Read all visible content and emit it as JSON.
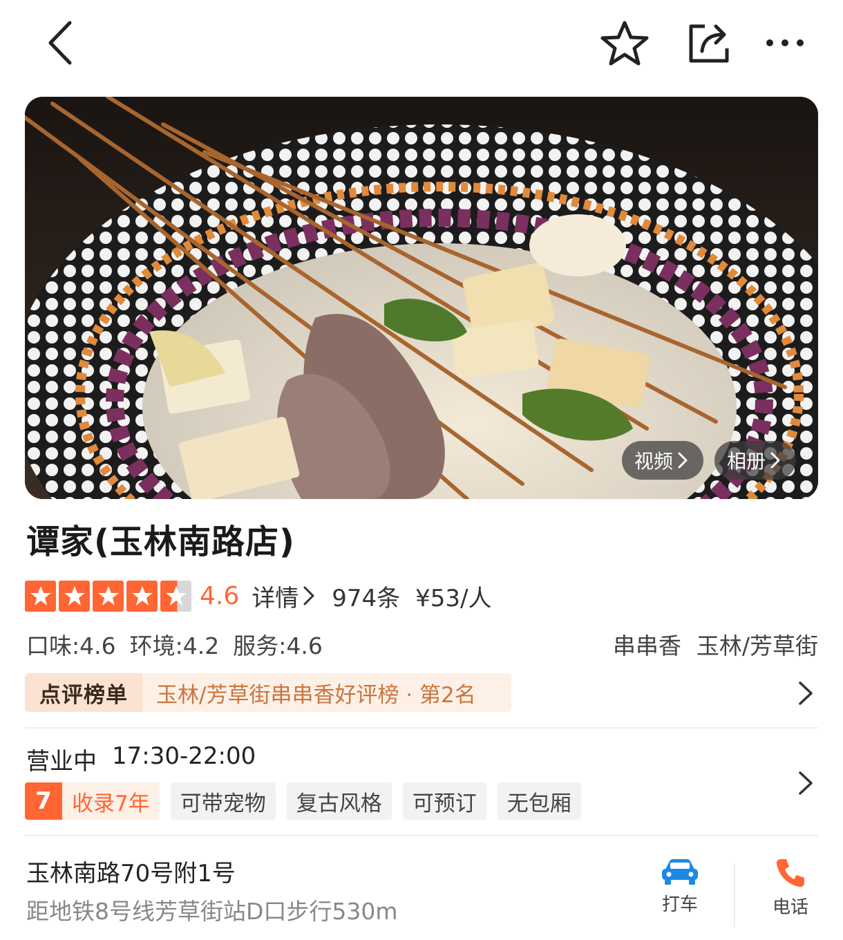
{
  "nav": {
    "back_icon": "chevron-left-icon",
    "favorite_icon": "star-outline-icon",
    "share_icon": "share-icon",
    "more_icon": "more-dots-icon"
  },
  "hero": {
    "video_label": "视频",
    "album_label": "相册"
  },
  "shop": {
    "name": "谭家(玉林南路店)",
    "rating_stars": 4.5,
    "score": "4.6",
    "detail_label": "详情",
    "reviews": "974条",
    "price": "¥53/人",
    "subscores": {
      "taste": "口味:4.6",
      "environment": "环境:4.2",
      "service": "服务:4.6"
    },
    "category": "串串香",
    "area": "玉林/芳草街"
  },
  "ranking": {
    "badge": "点评榜单",
    "text": "玉林/芳草街串串香好评榜 · 第2名"
  },
  "hours": {
    "status": "营业中",
    "time": "17:30-22:00"
  },
  "tags": {
    "years_num": "7",
    "years_text": "收录7年",
    "items": [
      "可带宠物",
      "复古风格",
      "可预订",
      "无包厢"
    ]
  },
  "address": {
    "street": "玉林南路70号附1号",
    "subway": "距地铁8号线芳草街站D口步行530m"
  },
  "actions": {
    "taxi_label": "打车",
    "call_label": "电话"
  },
  "colors": {
    "accent": "#ff6633",
    "rank_text": "#c9763f",
    "taxi_icon": "#1e88e5"
  }
}
